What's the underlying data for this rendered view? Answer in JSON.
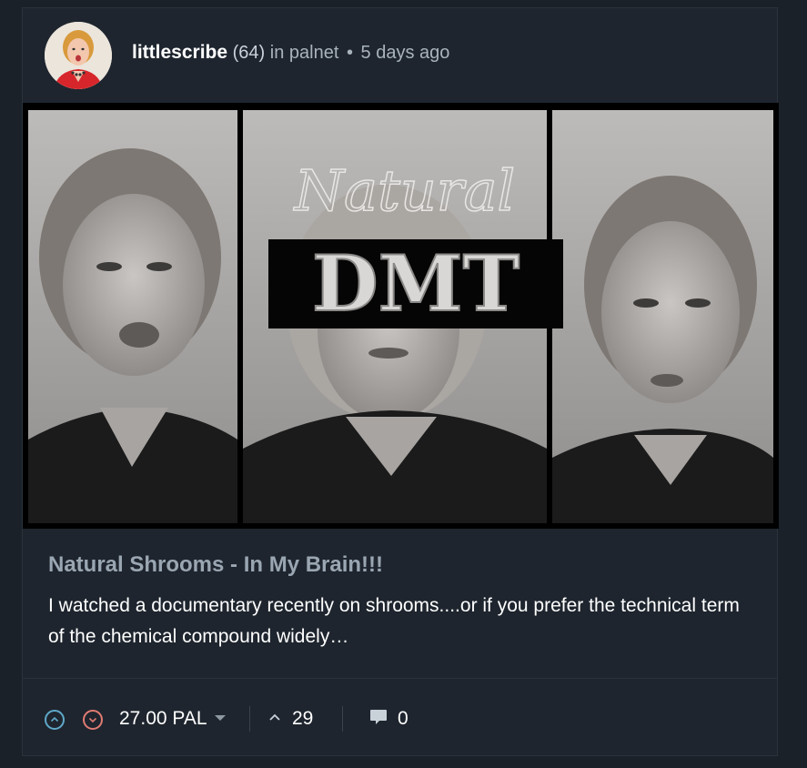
{
  "post": {
    "author": "littlescribe",
    "reputation": "(64)",
    "community_prefix": "in",
    "community": "palnet",
    "separator": "•",
    "age": "5 days ago",
    "image": {
      "overlay_script": "Natural",
      "overlay_block": "DMT"
    },
    "title": "Natural Shrooms - In My Brain!!!",
    "summary": "I watched a documentary recently on shrooms....or if you prefer the technical term of the chemical compound widely…"
  },
  "footer": {
    "payout": "27.00 PAL",
    "votes": "29",
    "comments": "0"
  },
  "colors": {
    "upvote": "#5fa8c9",
    "downvote": "#e07b73",
    "background": "#1b2129",
    "title": "#9aa6b2"
  }
}
